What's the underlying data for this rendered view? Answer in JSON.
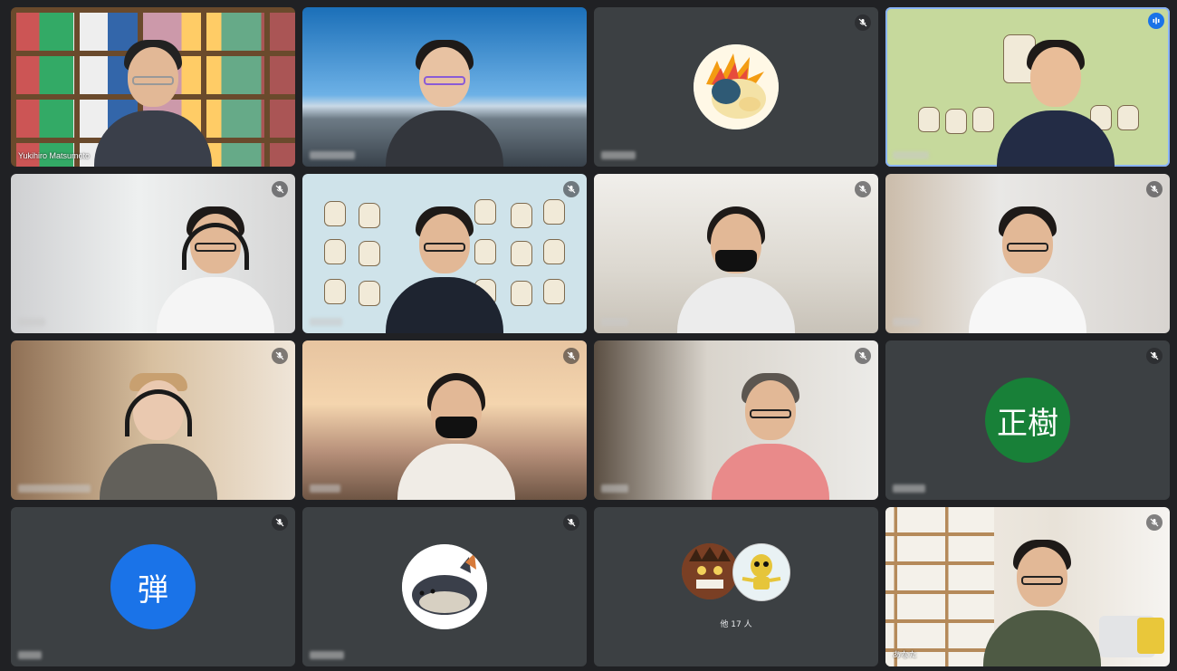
{
  "meeting": {
    "tiles": [
      {
        "row": 1,
        "col": 1,
        "type": "video",
        "background": "bookshelf",
        "name": "Yukihiro Matsumoto",
        "muted": false
      },
      {
        "row": 1,
        "col": 2,
        "type": "video",
        "background": "city-skyline",
        "name_hidden": true,
        "muted": false
      },
      {
        "row": 1,
        "col": 3,
        "type": "avatar-image",
        "avatar": "fire-mouse-icon",
        "name_hidden": true,
        "muted": true
      },
      {
        "row": 1,
        "col": 4,
        "type": "video",
        "background": "bear-illustration",
        "name_hidden": true,
        "speaking": true
      },
      {
        "row": 2,
        "col": 1,
        "type": "video",
        "background": "room",
        "name_hidden": true,
        "muted": true
      },
      {
        "row": 2,
        "col": 2,
        "type": "video",
        "background": "bear-pattern",
        "name_hidden": true,
        "muted": true
      },
      {
        "row": 2,
        "col": 3,
        "type": "video",
        "background": "cafe",
        "name_hidden": true,
        "muted": true
      },
      {
        "row": 2,
        "col": 4,
        "type": "video",
        "background": "bright-room",
        "name_hidden": true,
        "muted": true
      },
      {
        "row": 3,
        "col": 1,
        "type": "video",
        "background": "warm-room",
        "name_hidden": true,
        "muted": true
      },
      {
        "row": 3,
        "col": 2,
        "type": "video",
        "background": "sunset-apartment",
        "name_hidden": true,
        "muted": true
      },
      {
        "row": 3,
        "col": 3,
        "type": "video",
        "background": "plant-room",
        "name_hidden": true,
        "muted": true
      },
      {
        "row": 3,
        "col": 4,
        "type": "initial-avatar",
        "initial": "正樹",
        "avatar_color": "#188038",
        "name_hidden": true,
        "muted": true
      },
      {
        "row": 4,
        "col": 1,
        "type": "initial-avatar",
        "initial": "弾",
        "avatar_color": "#1a73e8",
        "name_hidden": true,
        "muted": true
      },
      {
        "row": 4,
        "col": 2,
        "type": "avatar-image",
        "avatar": "shiba-dog-icon",
        "name_hidden": true,
        "muted": true
      },
      {
        "row": 4,
        "col": 3,
        "type": "others",
        "others_label": "他 17 人"
      },
      {
        "row": 4,
        "col": 4,
        "type": "video",
        "background": "wooden-shelf",
        "name": "あなた",
        "muted": true
      }
    ]
  },
  "colors": {
    "page_bg": "#202124",
    "tile_bg": "#3c4043",
    "speaking_outline": "#8ab4f8",
    "speaking_icon": "#1a73e8"
  }
}
